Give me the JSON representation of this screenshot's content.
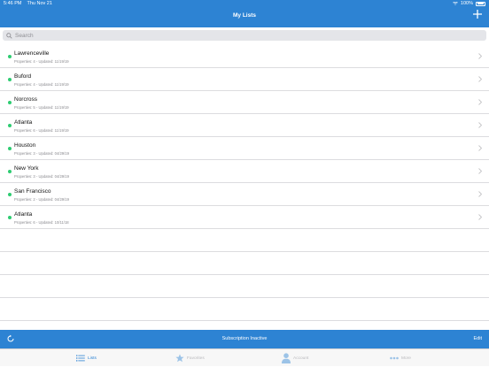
{
  "status_bar": {
    "time": "5:46 PM",
    "date": "Thu Nov 21",
    "battery": "100%"
  },
  "nav": {
    "title": "My Lists",
    "add_icon": "plus-icon"
  },
  "search": {
    "placeholder": "Search",
    "value": ""
  },
  "lists": [
    {
      "title": "Lawrenceville",
      "subtitle": "Properties: 4 - Updated: 11/19/19"
    },
    {
      "title": "Buford",
      "subtitle": "Properties: 4 - Updated: 11/19/19"
    },
    {
      "title": "Norcross",
      "subtitle": "Properties: 5 - Updated: 11/19/19"
    },
    {
      "title": "Atlanta",
      "subtitle": "Properties: 6 - Updated: 11/19/19"
    },
    {
      "title": "Houston",
      "subtitle": "Properties: 3 - Updated: 04/29/19"
    },
    {
      "title": "New York",
      "subtitle": "Properties: 3 - Updated: 04/29/19"
    },
    {
      "title": "San Francisco",
      "subtitle": "Properties: 2 - Updated: 04/29/19"
    },
    {
      "title": "Atlanta",
      "subtitle": "Properties: 6 - Updated: 10/11/18"
    }
  ],
  "toolbar": {
    "status_text": "Subscription Inactive",
    "edit_label": "Edit"
  },
  "tabs": [
    {
      "label": "Lists",
      "icon": "list-icon",
      "active": true
    },
    {
      "label": "Favorites",
      "icon": "star-icon",
      "active": false
    },
    {
      "label": "Account",
      "icon": "person-icon",
      "active": false
    },
    {
      "label": "More",
      "icon": "more-icon",
      "active": false
    }
  ],
  "colors": {
    "accent": "#2d83d3",
    "status_dot": "#2ecc71",
    "inactive_tab": "#b9b9bd"
  }
}
